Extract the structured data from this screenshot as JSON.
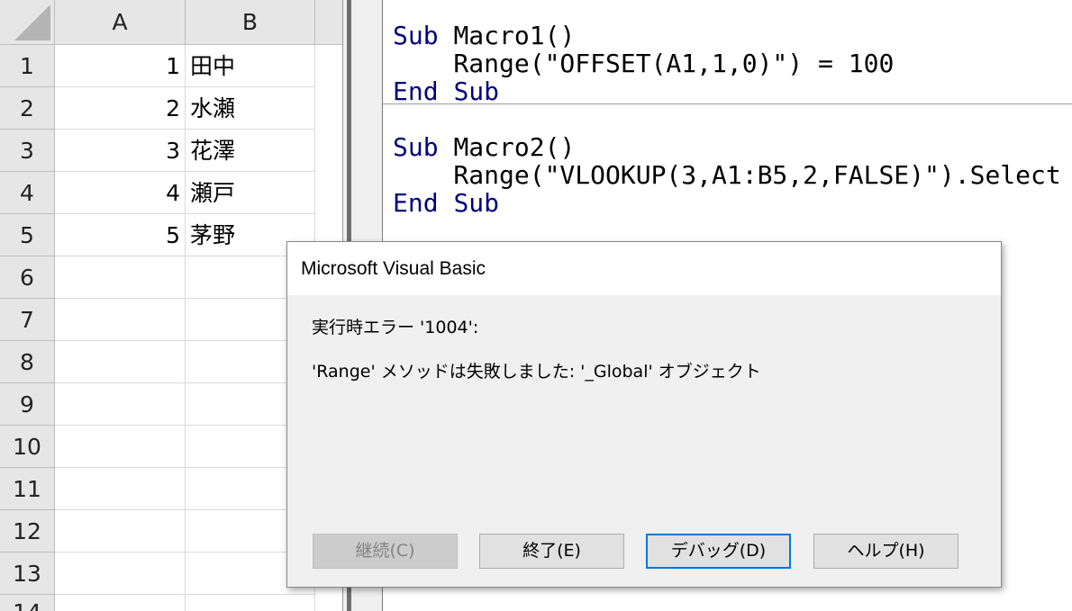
{
  "sheet": {
    "columns": [
      "A",
      "B"
    ],
    "rows": [
      "1",
      "2",
      "3",
      "4",
      "5",
      "6",
      "7",
      "8",
      "9",
      "10",
      "11",
      "12",
      "13",
      "14"
    ],
    "data": [
      {
        "a": "1",
        "b": "田中"
      },
      {
        "a": "2",
        "b": "水瀬"
      },
      {
        "a": "3",
        "b": "花澤"
      },
      {
        "a": "4",
        "b": "瀬戸"
      },
      {
        "a": "5",
        "b": "茅野"
      }
    ]
  },
  "code": {
    "macro1": {
      "sub_kw": "Sub",
      "name": "Macro1()",
      "body": "    Range(\"OFFSET(A1,1,0)\") = 100",
      "end_kw": "End",
      "end_sub_kw": "Sub"
    },
    "macro2": {
      "sub_kw": "Sub",
      "name": "Macro2()",
      "body": "    Range(\"VLOOKUP(3,A1:B5,2,FALSE)\").Select",
      "end_kw": "End",
      "end_sub_kw": "Sub"
    },
    "keyword_color": "#00007f"
  },
  "dialog": {
    "title": "Microsoft Visual Basic",
    "error_line": "実行時エラー '1004':",
    "message": "'Range' メソッドは失敗しました: '_Global' オブジェクト",
    "buttons": {
      "continue": "継続(C)",
      "end": "終了(E)",
      "debug": "デバッグ(D)",
      "help": "ヘルプ(H)"
    },
    "default_button_color": "#0078d7"
  }
}
